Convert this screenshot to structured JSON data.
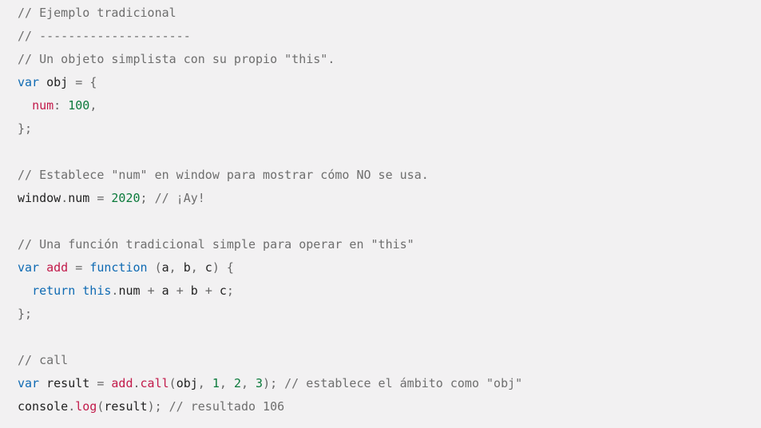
{
  "colors": {
    "background": "#f2f1f2",
    "comment": "#6e6e6e",
    "keyword": "#0e6ab3",
    "property": "#c21a4a",
    "number": "#0b7a3b",
    "punctuation": "#666666",
    "text": "#222222"
  },
  "lines": [
    [
      {
        "t": "comment",
        "v": "// Ejemplo tradicional"
      }
    ],
    [
      {
        "t": "comment",
        "v": "// ---------------------"
      }
    ],
    [
      {
        "t": "comment",
        "v": "// Un objeto simplista con su propio \"this\"."
      }
    ],
    [
      {
        "t": "keyword",
        "v": "var"
      },
      {
        "t": "plain",
        "v": " obj "
      },
      {
        "t": "punct",
        "v": "="
      },
      {
        "t": "plain",
        "v": " "
      },
      {
        "t": "punct",
        "v": "{"
      }
    ],
    [
      {
        "t": "plain",
        "v": "  "
      },
      {
        "t": "prop",
        "v": "num"
      },
      {
        "t": "punct",
        "v": ":"
      },
      {
        "t": "plain",
        "v": " "
      },
      {
        "t": "number",
        "v": "100"
      },
      {
        "t": "punct",
        "v": ","
      }
    ],
    [
      {
        "t": "punct",
        "v": "};"
      }
    ],
    [],
    [
      {
        "t": "comment",
        "v": "// Establece \"num\" en window para mostrar cómo NO se usa."
      }
    ],
    [
      {
        "t": "plain",
        "v": "window"
      },
      {
        "t": "punct",
        "v": "."
      },
      {
        "t": "plain",
        "v": "num "
      },
      {
        "t": "punct",
        "v": "="
      },
      {
        "t": "plain",
        "v": " "
      },
      {
        "t": "number",
        "v": "2020"
      },
      {
        "t": "punct",
        "v": ";"
      },
      {
        "t": "plain",
        "v": " "
      },
      {
        "t": "comment",
        "v": "// ¡Ay!"
      }
    ],
    [],
    [
      {
        "t": "comment",
        "v": "// Una función tradicional simple para operar en \"this\""
      }
    ],
    [
      {
        "t": "keyword",
        "v": "var"
      },
      {
        "t": "plain",
        "v": " "
      },
      {
        "t": "prop",
        "v": "add"
      },
      {
        "t": "plain",
        "v": " "
      },
      {
        "t": "punct",
        "v": "="
      },
      {
        "t": "plain",
        "v": " "
      },
      {
        "t": "keyword",
        "v": "function"
      },
      {
        "t": "plain",
        "v": " "
      },
      {
        "t": "punct",
        "v": "("
      },
      {
        "t": "plain",
        "v": "a"
      },
      {
        "t": "punct",
        "v": ","
      },
      {
        "t": "plain",
        "v": " b"
      },
      {
        "t": "punct",
        "v": ","
      },
      {
        "t": "plain",
        "v": " c"
      },
      {
        "t": "punct",
        "v": ")"
      },
      {
        "t": "plain",
        "v": " "
      },
      {
        "t": "punct",
        "v": "{"
      }
    ],
    [
      {
        "t": "plain",
        "v": "  "
      },
      {
        "t": "keyword",
        "v": "return"
      },
      {
        "t": "plain",
        "v": " "
      },
      {
        "t": "keyword",
        "v": "this"
      },
      {
        "t": "punct",
        "v": "."
      },
      {
        "t": "plain",
        "v": "num "
      },
      {
        "t": "punct",
        "v": "+"
      },
      {
        "t": "plain",
        "v": " a "
      },
      {
        "t": "punct",
        "v": "+"
      },
      {
        "t": "plain",
        "v": " b "
      },
      {
        "t": "punct",
        "v": "+"
      },
      {
        "t": "plain",
        "v": " c"
      },
      {
        "t": "punct",
        "v": ";"
      }
    ],
    [
      {
        "t": "punct",
        "v": "};"
      }
    ],
    [],
    [
      {
        "t": "comment",
        "v": "// call"
      }
    ],
    [
      {
        "t": "keyword",
        "v": "var"
      },
      {
        "t": "plain",
        "v": " result "
      },
      {
        "t": "punct",
        "v": "="
      },
      {
        "t": "plain",
        "v": " "
      },
      {
        "t": "prop",
        "v": "add"
      },
      {
        "t": "punct",
        "v": "."
      },
      {
        "t": "prop",
        "v": "call"
      },
      {
        "t": "punct",
        "v": "("
      },
      {
        "t": "plain",
        "v": "obj"
      },
      {
        "t": "punct",
        "v": ","
      },
      {
        "t": "plain",
        "v": " "
      },
      {
        "t": "number",
        "v": "1"
      },
      {
        "t": "punct",
        "v": ","
      },
      {
        "t": "plain",
        "v": " "
      },
      {
        "t": "number",
        "v": "2"
      },
      {
        "t": "punct",
        "v": ","
      },
      {
        "t": "plain",
        "v": " "
      },
      {
        "t": "number",
        "v": "3"
      },
      {
        "t": "punct",
        "v": ");"
      },
      {
        "t": "plain",
        "v": " "
      },
      {
        "t": "comment",
        "v": "// establece el ámbito como \"obj\""
      }
    ],
    [
      {
        "t": "plain",
        "v": "console"
      },
      {
        "t": "punct",
        "v": "."
      },
      {
        "t": "prop",
        "v": "log"
      },
      {
        "t": "punct",
        "v": "("
      },
      {
        "t": "plain",
        "v": "result"
      },
      {
        "t": "punct",
        "v": ");"
      },
      {
        "t": "plain",
        "v": " "
      },
      {
        "t": "comment",
        "v": "// resultado 106"
      }
    ]
  ]
}
